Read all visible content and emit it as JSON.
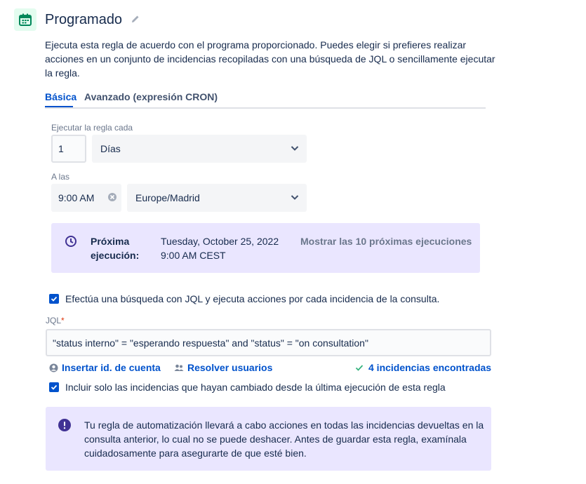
{
  "header": {
    "title": "Programado",
    "description": "Ejecuta esta regla de acuerdo con el programa proporcionado. Puedes elegir si prefieres realizar acciones en un conjunto de incidencias recopiladas con una búsqueda de JQL o sencillamente ejecutar la regla."
  },
  "tabs": [
    {
      "label": "Básica",
      "active": true
    },
    {
      "label": "Avanzado (expresión CRON)",
      "active": false
    }
  ],
  "schedule": {
    "run_label": "Ejecutar la regla cada",
    "interval_value": "1",
    "interval_unit": "Días",
    "at_label": "A las",
    "time_value": "9:00 AM",
    "timezone": "Europe/Madrid"
  },
  "next_run": {
    "label_line1": "Próxima",
    "label_line2": "ejecución:",
    "date": "Tuesday, October 25, 2022",
    "time": "9:00 AM CEST",
    "show_next_link": "Mostrar las 10 próximas ejecuciones"
  },
  "jql": {
    "checkbox_label": "Efectúa una búsqueda con JQL y ejecuta acciones por cada incidencia de la consulta.",
    "field_label": "JQL",
    "required_mark": "*",
    "query": "\"status interno\" = \"esperando respuesta\" and \"status\" = \"on consultation\"",
    "insert_account_link": "Insertar id. de cuenta",
    "resolve_users_link": "Resolver usuarios",
    "found_text": "4 incidencias encontradas",
    "only_changed_label": "Incluir solo las incidencias que hayan cambiado desde la última ejecución de esta regla"
  },
  "warning": {
    "text": "Tu regla de automatización llevará a cabo acciones en todas las incidencias devueltas en la consulta anterior, lo cual no se puede deshacer. Antes de guardar esta regla, examínala cuidadosamente para asegurarte de que esté bien."
  },
  "colors": {
    "primary": "#0052cc",
    "panel_purple": "#eae6ff",
    "icon_purple": "#403294",
    "success_green": "#36b37e",
    "trigger_green": "#00875a"
  },
  "icons": [
    "calendar-icon",
    "pencil-icon",
    "chevron-down-icon",
    "clear-icon",
    "clock-icon",
    "check-icon",
    "user-icon",
    "users-icon",
    "checkmark-icon",
    "exclamation-icon"
  ]
}
